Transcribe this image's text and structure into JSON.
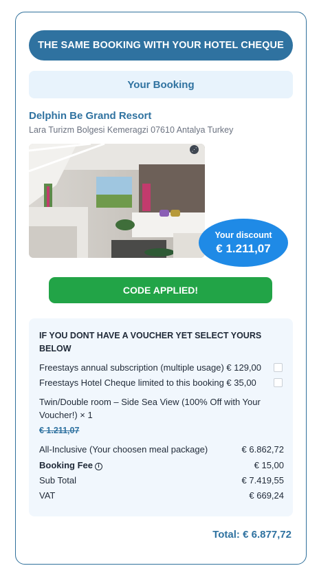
{
  "header": {
    "cta_label": "THE SAME BOOKING WITH YOUR HOTEL CHEQUE"
  },
  "booking": {
    "section_label": "Your Booking",
    "hotel_name": "Delphin Be Grand Resort",
    "address": "Lara Turizm Bolgesi Kemeragzi 07610 Antalya Turkey"
  },
  "discount": {
    "label": "Your discount",
    "amount": "€ 1.211,07"
  },
  "code_button": {
    "label": "CODE APPLIED!"
  },
  "summary": {
    "heading": "IF YOU DONT HAVE A VOUCHER YET SELECT YOURS BELOW",
    "options": [
      {
        "label": "Freestays annual subscription (multiple usage) € 129,00",
        "checked": false
      },
      {
        "label": "Freestays Hotel Cheque limited to this booking € 35,00",
        "checked": false
      }
    ],
    "room": {
      "description": "Twin/Double room – Side Sea View (100% Off with Your Voucher!) × 1",
      "old_price": "€ 1.211,07"
    },
    "lines": [
      {
        "label": "All-Inclusive (Your choosen meal package)",
        "value": "€ 6.862,72"
      },
      {
        "label": "Booking Fee",
        "value": "€ 15,00"
      },
      {
        "label": "Sub Total",
        "value": "€ 7.419,55"
      },
      {
        "label": "VAT",
        "value": "€ 669,24"
      }
    ],
    "total": "Total: € 6.877,72"
  },
  "icons": {
    "share": "share-icon",
    "info": "info-icon"
  },
  "colors": {
    "primary": "#2f72a0",
    "accent_blue": "#1f8ae6",
    "success": "#22a447",
    "panel": "#f1f7fd"
  }
}
